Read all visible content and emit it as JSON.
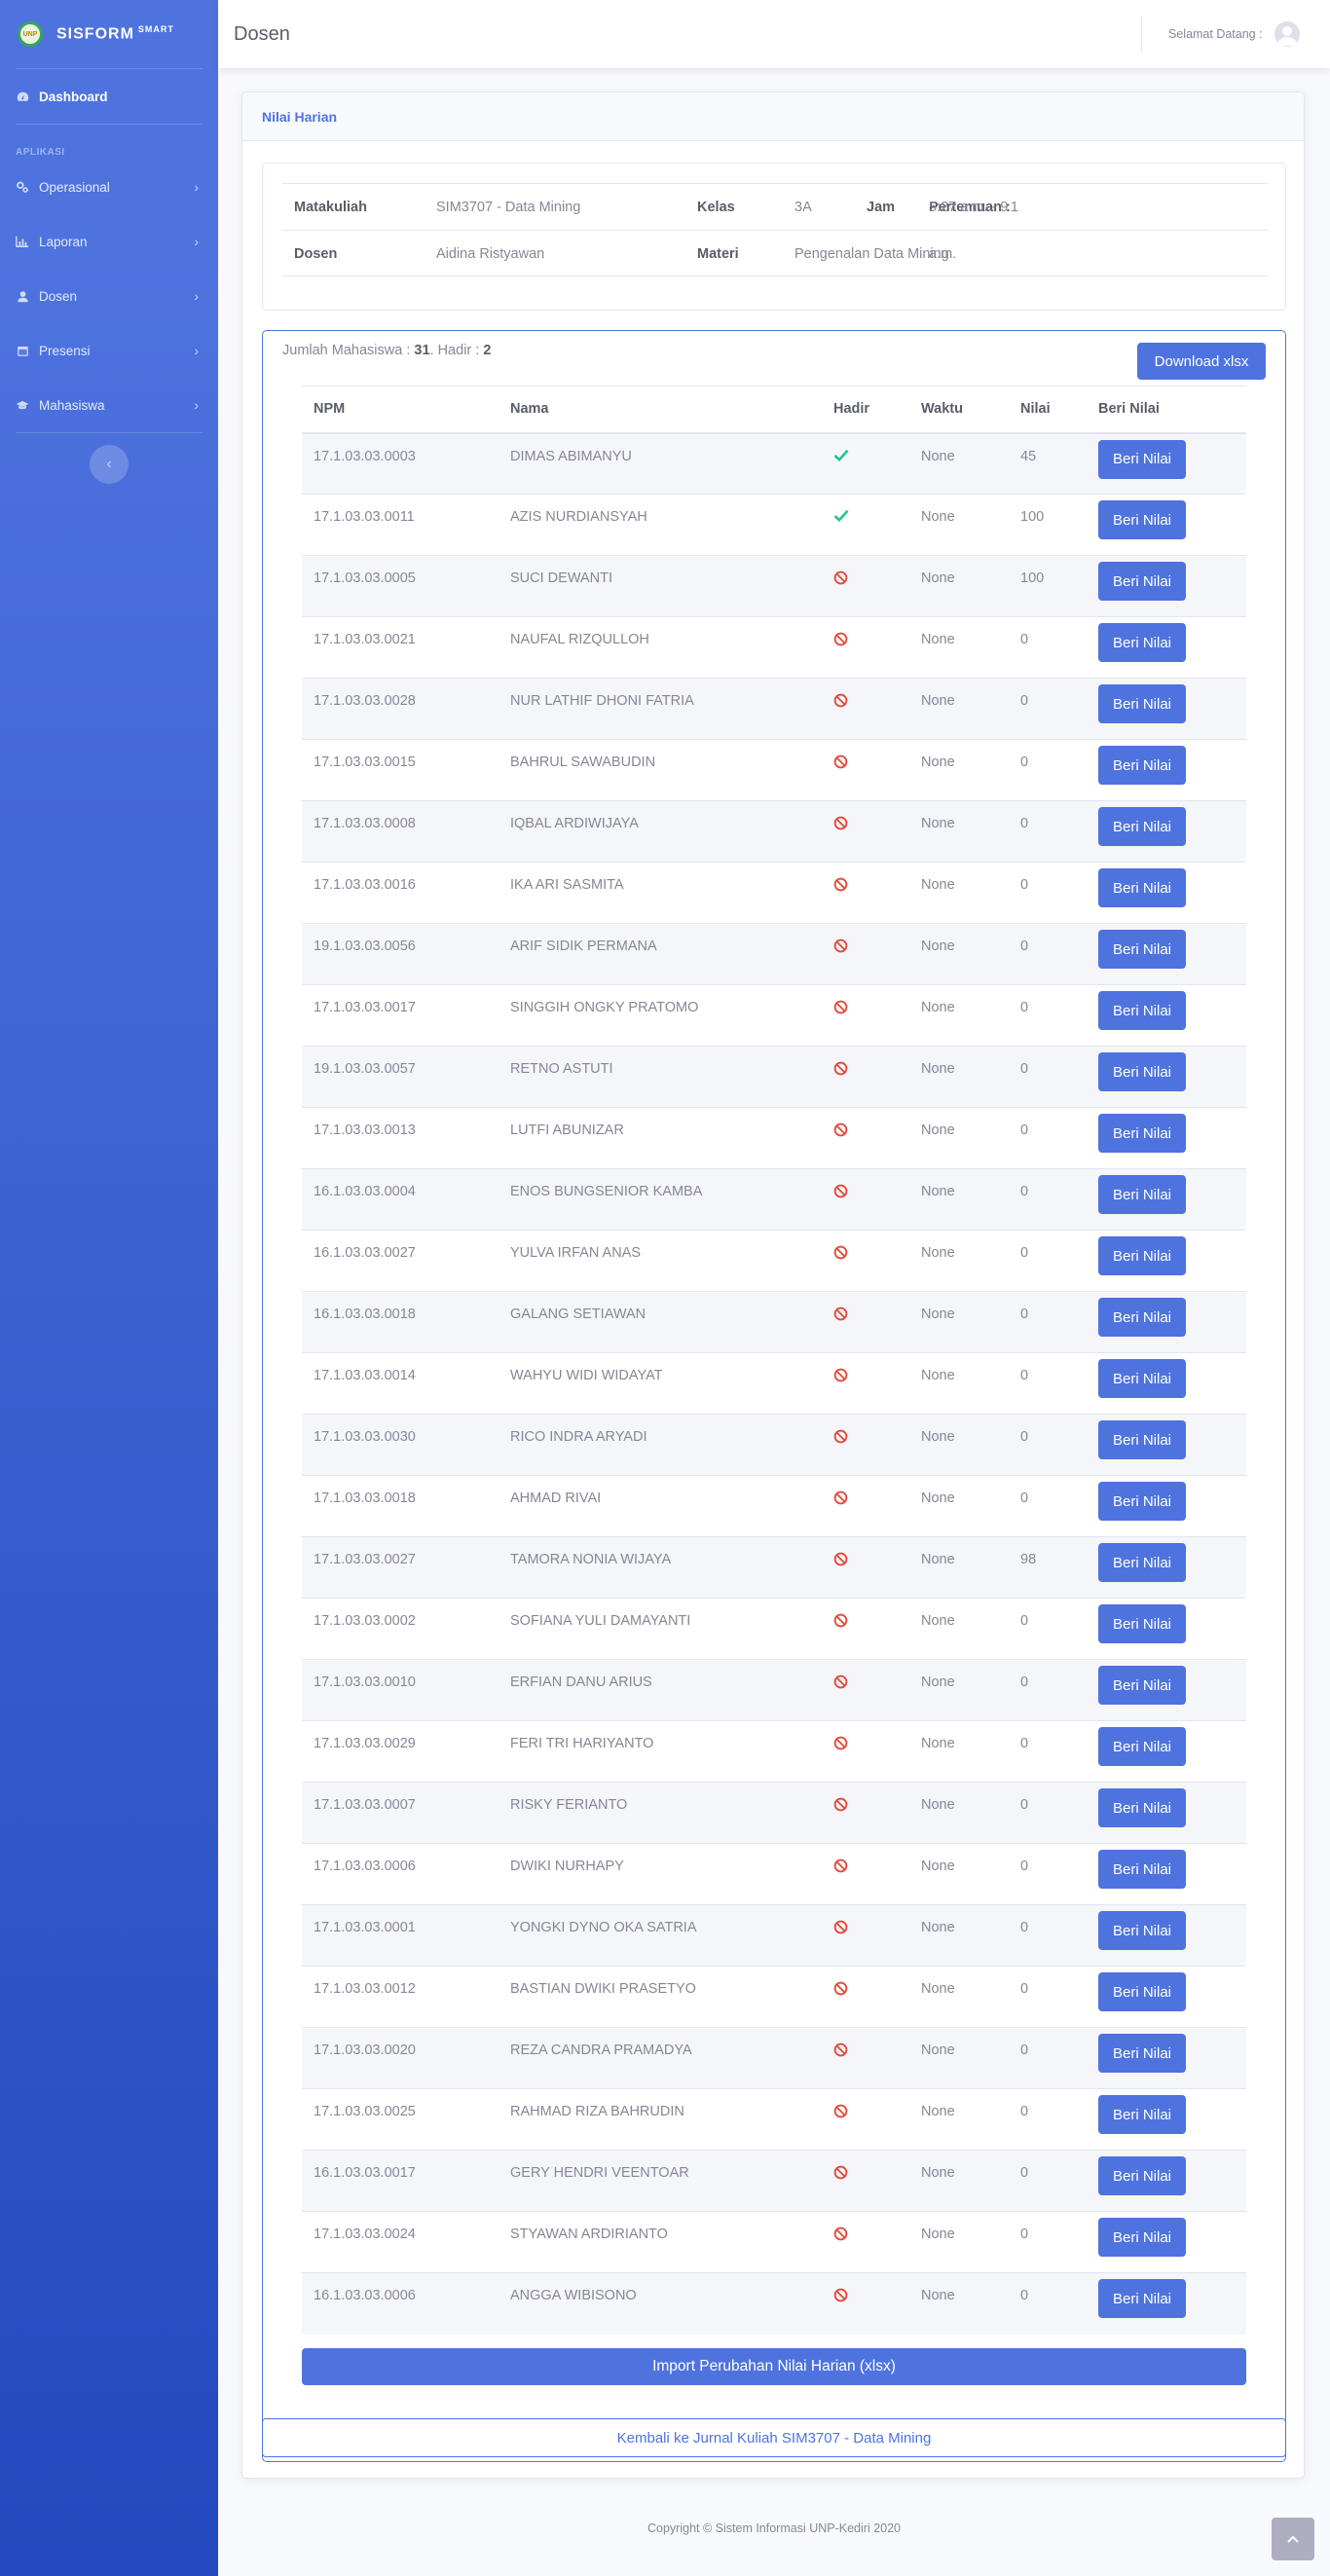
{
  "sidebar": {
    "brand": "SISFORM",
    "brand_sup": "SMART",
    "dashboard": "Dashboard",
    "heading": "APLIKASI",
    "items": [
      {
        "label": "Operasional",
        "icon": "cogs-icon"
      },
      {
        "label": "Laporan",
        "icon": "chart-icon"
      },
      {
        "label": "Dosen",
        "icon": "user-icon"
      },
      {
        "label": "Presensi",
        "icon": "calendar-icon"
      },
      {
        "label": "Mahasiswa",
        "icon": "graduation-cap-icon"
      }
    ],
    "toggle": "‹"
  },
  "topbar": {
    "title": "Dosen",
    "welcome": "Selamat Datang :"
  },
  "card": {
    "header": "Nilai Harian"
  },
  "info": {
    "matakuliah_label": "Matakuliah",
    "matakuliah": "SIM3707 - Data Mining",
    "kelas_label": "Kelas",
    "kelas": "3A",
    "jam_label": "Jam",
    "jam": "5:27 a.m. - 9 a.m.",
    "pertemuan_label": "Pertemuan :",
    "pertemuan": "1",
    "dosen_label": "Dosen",
    "dosen": "Aidina Ristyawan",
    "materi_label": "Materi",
    "materi": "Pengenalan Data Mining"
  },
  "summary": {
    "jumlah_label": "Jumlah Mahasiswa :",
    "jumlah": "31",
    "hadir_label": ". Hadir :",
    "hadir": "2"
  },
  "download_label": "Download xlsx",
  "table": {
    "headers": [
      "NPM",
      "Nama",
      "Hadir",
      "Waktu",
      "Nilai",
      "Beri Nilai"
    ],
    "button_label": "Beri Nilai",
    "rows": [
      {
        "npm": "17.1.03.03.0003",
        "nama": "DIMAS ABIMANYU",
        "hadir": true,
        "waktu": "None",
        "nilai": "45"
      },
      {
        "npm": "17.1.03.03.0011",
        "nama": "AZIS NURDIANSYAH",
        "hadir": true,
        "waktu": "None",
        "nilai": "100"
      },
      {
        "npm": "17.1.03.03.0005",
        "nama": "SUCI DEWANTI",
        "hadir": false,
        "waktu": "None",
        "nilai": "100"
      },
      {
        "npm": "17.1.03.03.0021",
        "nama": "NAUFAL RIZQULLOH",
        "hadir": false,
        "waktu": "None",
        "nilai": "0"
      },
      {
        "npm": "17.1.03.03.0028",
        "nama": "NUR LATHIF DHONI FATRIA",
        "hadir": false,
        "waktu": "None",
        "nilai": "0"
      },
      {
        "npm": "17.1.03.03.0015",
        "nama": "BAHRUL SAWABUDIN",
        "hadir": false,
        "waktu": "None",
        "nilai": "0"
      },
      {
        "npm": "17.1.03.03.0008",
        "nama": "IQBAL ARDIWIJAYA",
        "hadir": false,
        "waktu": "None",
        "nilai": "0"
      },
      {
        "npm": "17.1.03.03.0016",
        "nama": "IKA ARI SASMITA",
        "hadir": false,
        "waktu": "None",
        "nilai": "0"
      },
      {
        "npm": "19.1.03.03.0056",
        "nama": "ARIF SIDIK PERMANA",
        "hadir": false,
        "waktu": "None",
        "nilai": "0"
      },
      {
        "npm": "17.1.03.03.0017",
        "nama": "SINGGIH ONGKY PRATOMO",
        "hadir": false,
        "waktu": "None",
        "nilai": "0"
      },
      {
        "npm": "19.1.03.03.0057",
        "nama": "RETNO ASTUTI",
        "hadir": false,
        "waktu": "None",
        "nilai": "0"
      },
      {
        "npm": "17.1.03.03.0013",
        "nama": "LUTFI ABUNIZAR",
        "hadir": false,
        "waktu": "None",
        "nilai": "0"
      },
      {
        "npm": "16.1.03.03.0004",
        "nama": "ENOS BUNGSENIOR KAMBA",
        "hadir": false,
        "waktu": "None",
        "nilai": "0"
      },
      {
        "npm": "16.1.03.03.0027",
        "nama": "YULVA IRFAN ANAS",
        "hadir": false,
        "waktu": "None",
        "nilai": "0"
      },
      {
        "npm": "16.1.03.03.0018",
        "nama": "GALANG SETIAWAN",
        "hadir": false,
        "waktu": "None",
        "nilai": "0"
      },
      {
        "npm": "17.1.03.03.0014",
        "nama": "WAHYU WIDI WIDAYAT",
        "hadir": false,
        "waktu": "None",
        "nilai": "0"
      },
      {
        "npm": "17.1.03.03.0030",
        "nama": "RICO INDRA ARYADI",
        "hadir": false,
        "waktu": "None",
        "nilai": "0"
      },
      {
        "npm": "17.1.03.03.0018",
        "nama": "AHMAD RIVAI",
        "hadir": false,
        "waktu": "None",
        "nilai": "0"
      },
      {
        "npm": "17.1.03.03.0027",
        "nama": "TAMORA NONIA WIJAYA",
        "hadir": false,
        "waktu": "None",
        "nilai": "98"
      },
      {
        "npm": "17.1.03.03.0002",
        "nama": "SOFIANA YULI DAMAYANTI",
        "hadir": false,
        "waktu": "None",
        "nilai": "0"
      },
      {
        "npm": "17.1.03.03.0010",
        "nama": "ERFIAN DANU ARIUS",
        "hadir": false,
        "waktu": "None",
        "nilai": "0"
      },
      {
        "npm": "17.1.03.03.0029",
        "nama": "FERI TRI HARIYANTO",
        "hadir": false,
        "waktu": "None",
        "nilai": "0"
      },
      {
        "npm": "17.1.03.03.0007",
        "nama": "RISKY FERIANTO",
        "hadir": false,
        "waktu": "None",
        "nilai": "0"
      },
      {
        "npm": "17.1.03.03.0006",
        "nama": "DWIKI NURHAPY",
        "hadir": false,
        "waktu": "None",
        "nilai": "0"
      },
      {
        "npm": "17.1.03.03.0001",
        "nama": "YONGKI DYNO OKA SATRIA",
        "hadir": false,
        "waktu": "None",
        "nilai": "0"
      },
      {
        "npm": "17.1.03.03.0012",
        "nama": "BASTIAN DWIKI PRASETYO",
        "hadir": false,
        "waktu": "None",
        "nilai": "0"
      },
      {
        "npm": "17.1.03.03.0020",
        "nama": "REZA CANDRA PRAMADYA",
        "hadir": false,
        "waktu": "None",
        "nilai": "0"
      },
      {
        "npm": "17.1.03.03.0025",
        "nama": "RAHMAD RIZA BAHRUDIN",
        "hadir": false,
        "waktu": "None",
        "nilai": "0"
      },
      {
        "npm": "16.1.03.03.0017",
        "nama": "GERY HENDRI VEENTOAR",
        "hadir": false,
        "waktu": "None",
        "nilai": "0"
      },
      {
        "npm": "17.1.03.03.0024",
        "nama": "STYAWAN ARDIRIANTO",
        "hadir": false,
        "waktu": "None",
        "nilai": "0"
      },
      {
        "npm": "16.1.03.03.0006",
        "nama": "ANGGA WIBISONO",
        "hadir": false,
        "waktu": "None",
        "nilai": "0"
      }
    ]
  },
  "import_label": "Import Perubahan Nilai Harian (xlsx)",
  "back_label": "Kembali ke Jurnal Kuliah SIM3707 - Data Mining",
  "footer": "Copyright © Sistem Informasi UNP-Kediri 2020",
  "colors": {
    "primary": "#4e73df",
    "success": "#1cc88a",
    "danger": "#e74a3b"
  }
}
